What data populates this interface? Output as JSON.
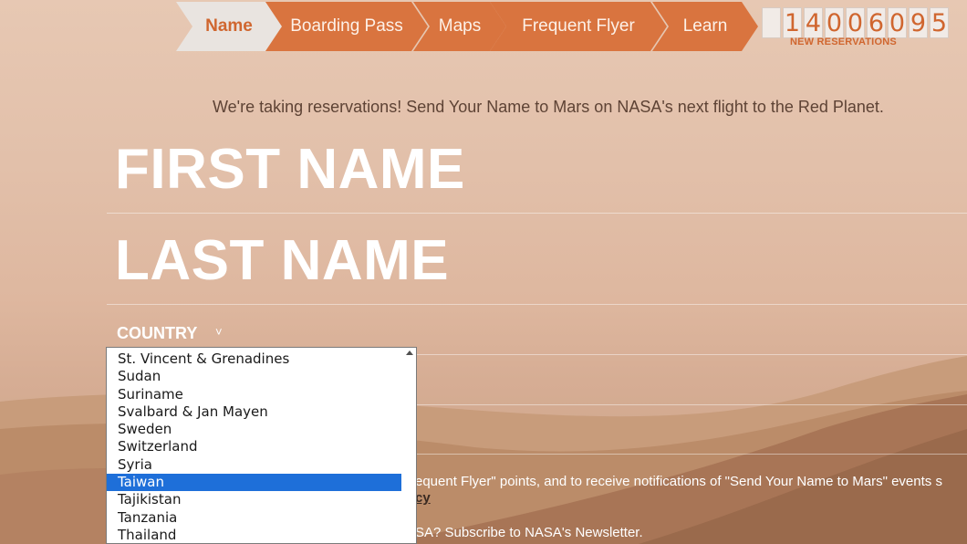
{
  "nav": {
    "steps": [
      {
        "label": "Name",
        "active": true
      },
      {
        "label": "Boarding Pass",
        "active": false
      },
      {
        "label": "Maps",
        "active": false
      },
      {
        "label": "Frequent Flyer",
        "active": false
      },
      {
        "label": "Learn",
        "active": false
      }
    ]
  },
  "counter": {
    "digits": [
      "",
      "1",
      "4",
      "0",
      "0",
      "6",
      "0",
      "9",
      "5"
    ],
    "label": "NEW RESERVATIONS"
  },
  "tagline": "We're taking reservations! Send Your Name to Mars on NASA's next flight to the Red Planet.",
  "form": {
    "first_name_label": "FIRST NAME",
    "last_name_label": "LAST NAME",
    "country_label": "COUNTRY",
    "country_chevron": "˅"
  },
  "country_dropdown": {
    "options": [
      "St. Vincent & Grenadines",
      "Sudan",
      "Suriname",
      "Svalbard & Jan Mayen",
      "Sweden",
      "Switzerland",
      "Syria",
      "Taiwan",
      "Tajikistan",
      "Tanzania",
      "Thailand"
    ],
    "selected": "Taiwan"
  },
  "footer": {
    "consent_text": "equent Flyer\" points, and to receive notifications of \"Send Your Name to Mars\" events s",
    "policy_link": "cy",
    "newsletter_text": "SA? Subscribe to NASA's Newsletter."
  },
  "colors": {
    "accent": "#d9743f",
    "active_tab_bg": "#e9e4e0",
    "selection": "#1e6fd9"
  }
}
